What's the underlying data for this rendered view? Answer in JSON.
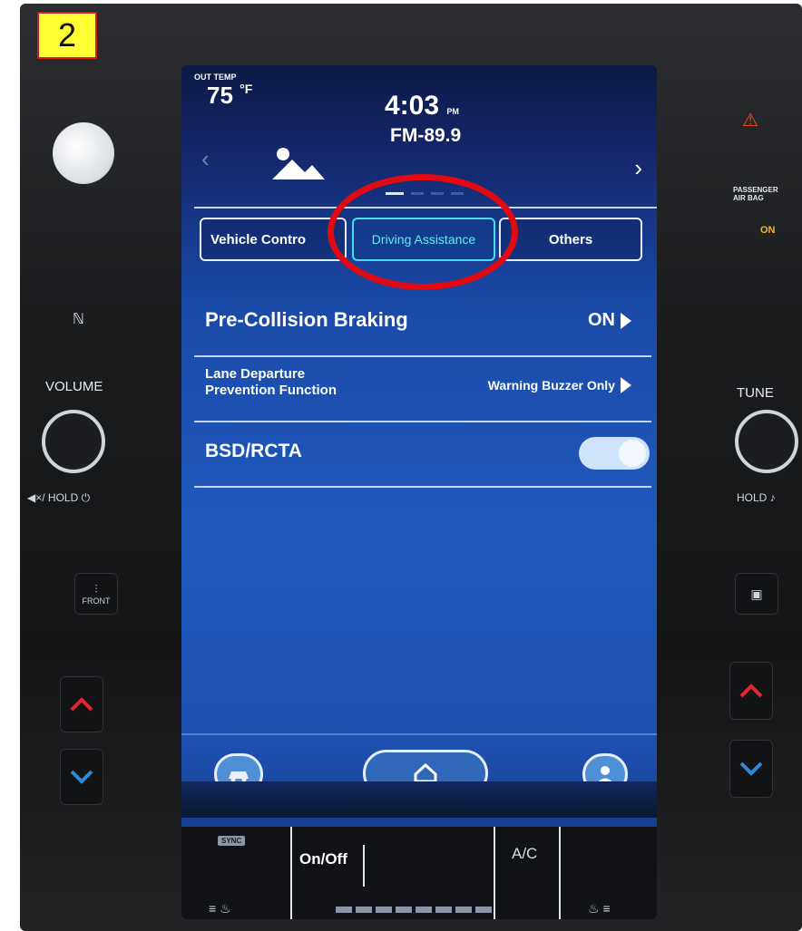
{
  "step_badge": "2",
  "status": {
    "out_temp_label": "OUT TEMP",
    "out_temp_value": "75",
    "out_temp_unit": "°F",
    "time": "4:03",
    "ampm": "PM",
    "radio": "FM-89.9",
    "page_count": 4,
    "active_page": 1
  },
  "tabs": [
    {
      "label": "Vehicle Contro",
      "selected": false
    },
    {
      "label": "Driving Assistance",
      "selected": true
    },
    {
      "label": "Others",
      "selected": false
    }
  ],
  "settings": {
    "pre_collision": {
      "label": "Pre-Collision Braking",
      "value": "ON"
    },
    "lane_departure": {
      "label_line1": "Lane Departure",
      "label_line2": "Prevention Function",
      "value": "Warning Buzzer Only"
    },
    "bsd_rcta": {
      "label": "BSD/RCTA",
      "enabled": true
    }
  },
  "dock": {
    "left_icon": "car-icon",
    "home_icon": "home-icon",
    "right_icon": "user-icon"
  },
  "climate": {
    "sync_label": "SYNC",
    "on_off": "On/Off",
    "ac": "A/C",
    "a_c_indicator": "—"
  },
  "side_controls": {
    "volume_label": "VOLUME",
    "tune_label": "TUNE",
    "volume_hold": "◀×/ HOLD ⏻",
    "tune_hold": "HOLD ♪",
    "defrost_label": "FRONT",
    "airbag_label": "PASSENGER AIR BAG",
    "airbag_status": "ON",
    "nfc_icon": "nfc-icon"
  },
  "colors": {
    "highlight_ring": "#e10a12",
    "selected_tab": "#42e0ec",
    "badge_bg": "#ffff33"
  }
}
